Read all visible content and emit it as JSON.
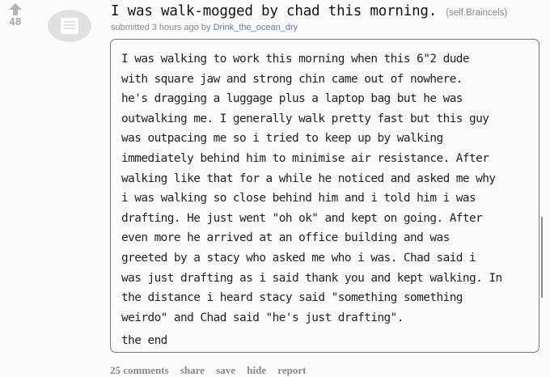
{
  "post": {
    "score": "48",
    "title": "I was walk-mogged by chad this morning.",
    "domain": "(self.Braincels)",
    "tagline_prefix": "submitted 3 hours ago by",
    "author": "Drink_the_ocean_dry",
    "body_lines": [
      "I was walking to work this morning when this 6\"2 dude",
      "with square jaw and strong chin came out of nowhere.",
      "he's dragging a luggage plus a laptop bag but he was",
      "outwalking me. I generally walk pretty fast but this guy",
      "was outpacing me so i tried to keep up by walking",
      "immediately behind him to minimise air resistance. After",
      "walking like that for a while he noticed and asked me why",
      "i was walking so close behind him and i told him i was",
      "drafting. He just went \"oh ok\" and kept on going. After",
      "even more he arrived at an office building and was",
      "greeted by a stacy who asked me who i was. Chad said i",
      "was just drafting as i said thank you and kept walking. In",
      "the distance i heard stacy said \"something something",
      "weirdo\" and Chad said \"he's just drafting\"."
    ],
    "body_end": "the end"
  },
  "buttons": {
    "comments": "25 comments",
    "share": "share",
    "save": "save",
    "hide": "hide",
    "report": "report"
  },
  "icons": {
    "upvote": "upvote-arrow-icon",
    "thumbnail": "self-post-text-icon"
  },
  "colors": {
    "author_link": "#5a7fb0",
    "muted": "#888888",
    "thumbnail_bg": "#dfe0e0"
  }
}
